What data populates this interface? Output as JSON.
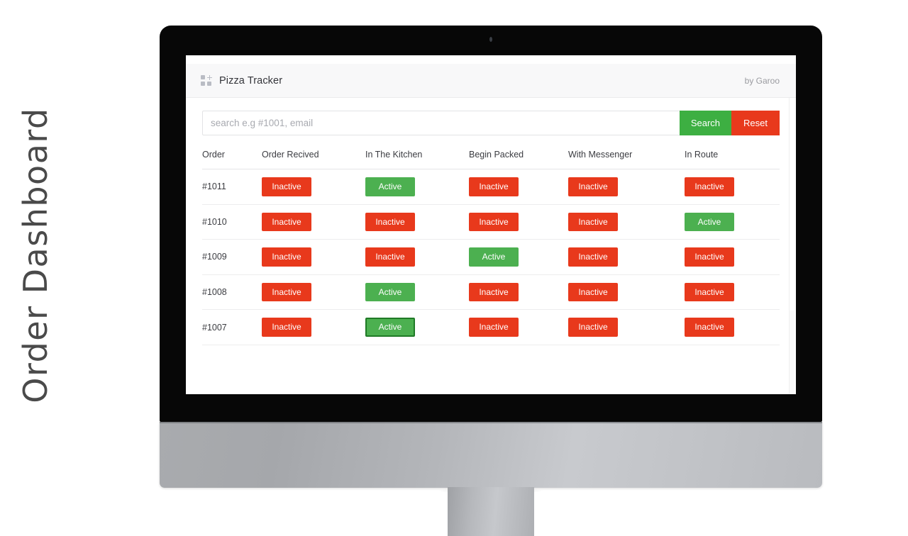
{
  "page": {
    "side_caption": "Order Dashboard",
    "background_color": "#ffffff"
  },
  "device": {
    "type": "desktop-monitor",
    "bezel_color": "#070707",
    "chin_color": "#b6b8bc",
    "camera": "camera-dot"
  },
  "app": {
    "header": {
      "icon": "grid-plus-icon",
      "title": "Pizza Tracker",
      "byline": "by Garoo"
    },
    "search": {
      "placeholder": "search e.g #1001, email",
      "value": "",
      "search_label": "Search",
      "reset_label": "Reset",
      "search_color": "#3daf42",
      "reset_color": "#e8391c"
    },
    "table": {
      "headers": [
        "Order",
        "Order Recived",
        "In The Kitchen",
        "Begin Packed",
        "With Messenger",
        "In Route"
      ],
      "status_labels": {
        "active": "Active",
        "inactive": "Inactive"
      },
      "status_colors": {
        "active": "#4cb050",
        "inactive": "#e8391c",
        "active_focus_border": "#1f7a26"
      },
      "rows": [
        {
          "order": "#1011",
          "statuses": [
            "Inactive",
            "Active",
            "Inactive",
            "Inactive",
            "Inactive"
          ],
          "focused_index": -1
        },
        {
          "order": "#1010",
          "statuses": [
            "Inactive",
            "Inactive",
            "Inactive",
            "Inactive",
            "Active"
          ],
          "focused_index": -1
        },
        {
          "order": "#1009",
          "statuses": [
            "Inactive",
            "Inactive",
            "Active",
            "Inactive",
            "Inactive"
          ],
          "focused_index": -1
        },
        {
          "order": "#1008",
          "statuses": [
            "Inactive",
            "Active",
            "Inactive",
            "Inactive",
            "Inactive"
          ],
          "focused_index": -1
        },
        {
          "order": "#1007",
          "statuses": [
            "Inactive",
            "Active",
            "Inactive",
            "Inactive",
            "Inactive"
          ],
          "focused_index": 1
        }
      ]
    }
  }
}
